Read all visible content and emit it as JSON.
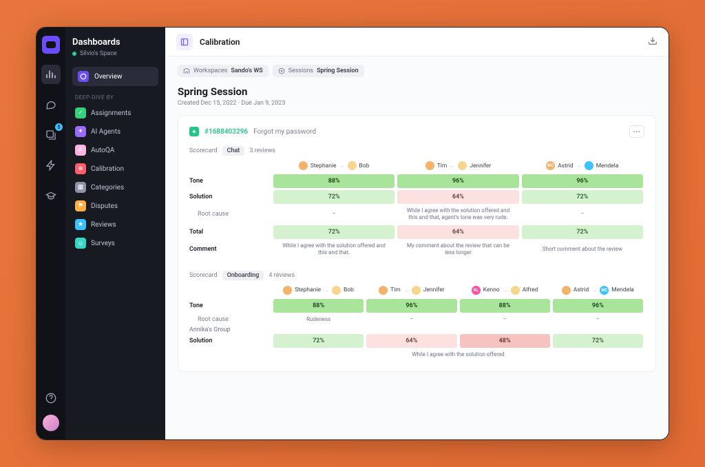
{
  "rail": {
    "badge": "5"
  },
  "sidebar": {
    "title": "Dashboards",
    "space": "Silvio's Space",
    "overview": "Overview",
    "section_label": "DEEP-DIVE BY",
    "items": [
      {
        "label": "Assignments",
        "color": "#37d17c"
      },
      {
        "label": "AI Agents",
        "color": "#9b6bff"
      },
      {
        "label": "AutoQA",
        "color": "#ffb4e1"
      },
      {
        "label": "Calibration",
        "color": "#ff5c6c"
      },
      {
        "label": "Categories",
        "color": "#8c93a6"
      },
      {
        "label": "Disputes",
        "color": "#ffae42"
      },
      {
        "label": "Reviews",
        "color": "#3cc3ff"
      },
      {
        "label": "Surveys",
        "color": "#36d6c7"
      }
    ]
  },
  "topbar": {
    "title": "Calibration"
  },
  "breadcrumbs": [
    {
      "prefix": "Workspaces",
      "value": "Sando's WS"
    },
    {
      "prefix": "Sessions",
      "value": "Spring Session"
    }
  ],
  "page": {
    "title": "Spring Session",
    "subtitle": "Created Dec 15, 2022  ·  Due Jan 9, 2023"
  },
  "ticket": {
    "id": "#1688403296",
    "subject": "Forgot my password"
  },
  "scorecards": [
    {
      "label": "Scorecard",
      "pill": "Chat",
      "reviews": "3 reviews",
      "reviewers": [
        {
          "from": "Stephanie",
          "to": "Bob",
          "c1": "#f5b26b",
          "c2": "#f6d58c"
        },
        {
          "from": "Tim",
          "to": "Jennifer",
          "c1": "#f5b26b",
          "c2": "#f6d58c"
        },
        {
          "from": "Astrid",
          "to": "Mendela",
          "c1": "#f5b26b",
          "c2": "#3cc3ff",
          "initials": "MC"
        }
      ],
      "rows": [
        {
          "label": "Tone",
          "type": "score",
          "cells": [
            {
              "v": "88%",
              "cls": "green"
            },
            {
              "v": "96%",
              "cls": "green"
            },
            {
              "v": "96%",
              "cls": "green"
            }
          ]
        },
        {
          "label": "Solution",
          "type": "score",
          "cells": [
            {
              "v": "72%",
              "cls": "lt-green"
            },
            {
              "v": "64%",
              "cls": "lt-red"
            },
            {
              "v": "72%",
              "cls": "lt-green"
            }
          ]
        },
        {
          "label": "Root cause",
          "type": "text",
          "sub": true,
          "cells": [
            {
              "v": "–"
            },
            {
              "v": "While I agree with the solution offered and this and that, agent's tone was very rude."
            },
            {
              "v": "–"
            }
          ]
        },
        {
          "label": "Total",
          "type": "score",
          "cells": [
            {
              "v": "72%",
              "cls": "lt-green"
            },
            {
              "v": "64%",
              "cls": "lt-red"
            },
            {
              "v": "72%",
              "cls": "lt-green"
            }
          ]
        },
        {
          "label": "Comment",
          "type": "text",
          "cells": [
            {
              "v": "While I agree with the solution offered and this and that."
            },
            {
              "v": "My comment about the review that can be less longer"
            },
            {
              "v": "Short comment about the review"
            }
          ]
        }
      ]
    },
    {
      "label": "Scorecard",
      "pill": "Onboarding",
      "reviews": "4 reviews",
      "group": "Annika's Group",
      "reviewers": [
        {
          "from": "Stephanie",
          "to": "Bob",
          "c1": "#f5b26b",
          "c2": "#f6d58c"
        },
        {
          "from": "Tim",
          "to": "Jennifer",
          "c1": "#f5b26b",
          "c2": "#f6d58c"
        },
        {
          "from": "Kenno",
          "to": "Alfred",
          "c1": "#ff4fa0",
          "c2": "#f6d58c",
          "initials": "KL"
        },
        {
          "from": "Astrid",
          "to": "Mendela",
          "c1": "#f5b26b",
          "c2": "#3cc3ff",
          "initials2": "MC"
        }
      ],
      "rows": [
        {
          "label": "Tone",
          "type": "score",
          "cells": [
            {
              "v": "88%",
              "cls": "green"
            },
            {
              "v": "96%",
              "cls": "green"
            },
            {
              "v": "88%",
              "cls": "green"
            },
            {
              "v": "96%",
              "cls": "green"
            }
          ]
        },
        {
          "label": "Root cause",
          "type": "text",
          "sub": true,
          "cells": [
            {
              "v": "Rudeness"
            },
            {
              "v": "–"
            },
            {
              "v": "–"
            },
            {
              "v": "–"
            }
          ]
        },
        {
          "label": "Solution",
          "type": "score",
          "cells": [
            {
              "v": "72%",
              "cls": "lt-green"
            },
            {
              "v": "64%",
              "cls": "lt-red"
            },
            {
              "v": "48%",
              "cls": "red"
            },
            {
              "v": "72%",
              "cls": "lt-green"
            }
          ]
        },
        {
          "label": "",
          "type": "text",
          "cells": {
            "span": "While I agree with the solution offered"
          }
        }
      ]
    }
  ]
}
